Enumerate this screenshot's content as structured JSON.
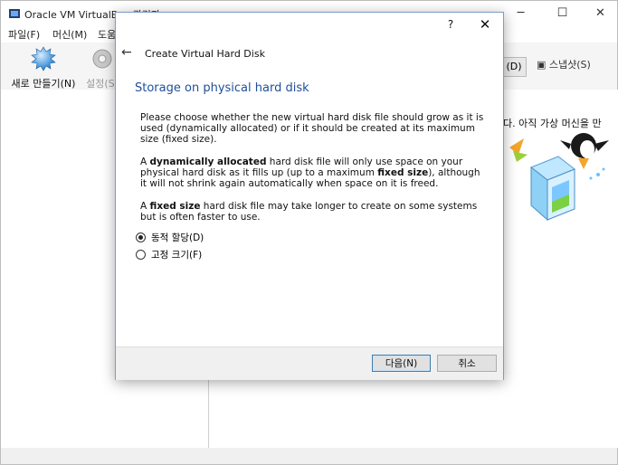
{
  "app": {
    "title": "Oracle VM VirtualBox 관리자",
    "menus": [
      "파일(F)",
      "머신(M)",
      "도움"
    ],
    "toolbar": {
      "new_label": "새로 만들기(N)",
      "settings_label": "설정(S)"
    },
    "tabs": {
      "details": "(D)",
      "snapshots": "스냅샷(S)"
    },
    "welcome_text": "다. 아직 가상 머신을 만"
  },
  "dialog": {
    "help": "?",
    "close": "✕",
    "back": "←",
    "title": "Create Virtual Hard Disk",
    "heading": "Storage on physical hard disk",
    "para1": "Please choose whether the new virtual hard disk file should grow as it is used (dynamically allocated) or if it should be created at its maximum size (fixed size).",
    "para2_prefix": "A ",
    "para2_bold1": "dynamically allocated",
    "para2_mid": " hard disk file will only use space on your physical hard disk as it fills up (up to a maximum ",
    "para2_bold2": "fixed size",
    "para2_suffix": "), although it will not shrink again automatically when space on it is freed.",
    "para3_prefix": "A ",
    "para3_bold": "fixed size",
    "para3_suffix": " hard disk file may take longer to create on some systems but is often faster to use.",
    "options": [
      {
        "label": "동적 할당(D)",
        "checked": true
      },
      {
        "label": "고정 크기(F)",
        "checked": false
      }
    ],
    "next_button": "다음(N)",
    "cancel_button": "취소"
  }
}
